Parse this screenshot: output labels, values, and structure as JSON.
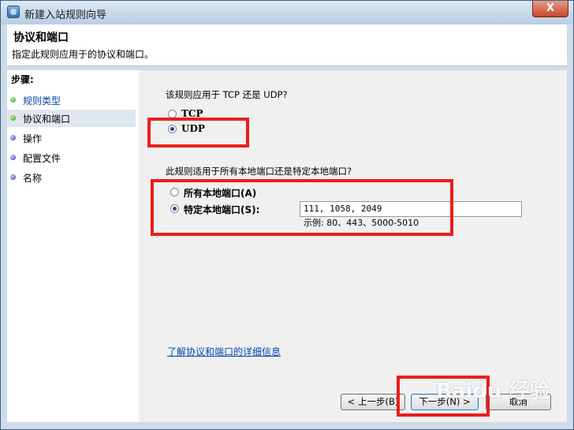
{
  "window": {
    "title": "新建入站规则向导",
    "close_glyph": "X"
  },
  "header": {
    "title": "协议和端口",
    "subtitle": "指定此规则应用于的协议和端口。"
  },
  "steps": {
    "heading": "步骤:",
    "items": [
      {
        "label": "规则类型",
        "state": "done"
      },
      {
        "label": "协议和端口",
        "state": "current"
      },
      {
        "label": "操作",
        "state": "todo"
      },
      {
        "label": "配置文件",
        "state": "todo"
      },
      {
        "label": "名称",
        "state": "todo"
      }
    ]
  },
  "protocol": {
    "question": "该规则应用于 TCP 还是 UDP?",
    "options": [
      {
        "label": "TCP",
        "checked": false
      },
      {
        "label": "UDP",
        "checked": true
      }
    ]
  },
  "ports": {
    "question": "此规则适用于所有本地端口还是特定本地端口?",
    "options": [
      {
        "label": "所有本地端口(A)",
        "checked": false
      },
      {
        "label": "特定本地端口(S):",
        "checked": true
      }
    ],
    "value": "111, 1058, 2049",
    "example": "示例: 80、443、5000-5010"
  },
  "help_link": "了解协议和端口的详细信息",
  "buttons": {
    "back": "< 上一步(B)",
    "next": "下一步(N) >",
    "cancel": "取消"
  },
  "watermark": "Baidu 经验"
}
